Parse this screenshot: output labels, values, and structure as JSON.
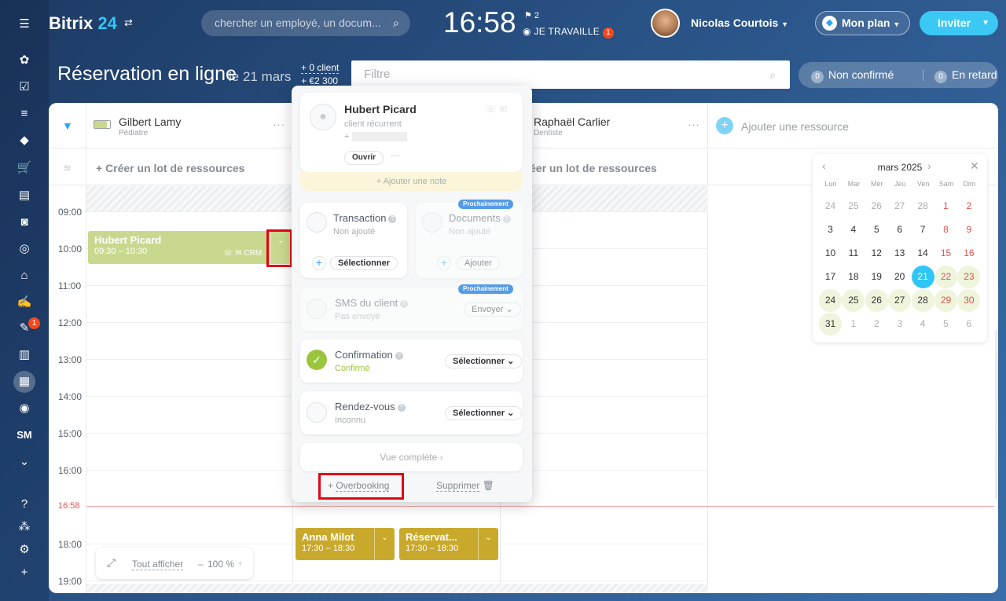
{
  "header": {
    "logo_text": "Bitrix",
    "logo_num": "24",
    "search_placeholder": "chercher un employé, un docum...",
    "clock": "16:58",
    "flag_count": "2",
    "work_status": "JE TRAVAILLE",
    "work_badge": "1",
    "user_name": "Nicolas Courtois",
    "plan_label": "Mon plan",
    "invite_label": "Inviter"
  },
  "sidebar": {
    "badge": "1",
    "sm_label": "SM"
  },
  "page": {
    "title": "Réservation en ligne",
    "date": "le 21 mars",
    "stat_clients": "+ 0 client",
    "stat_money": "+ €2 300",
    "filter_placeholder": "Filtre",
    "unconfirmed_count": "0",
    "unconfirmed_label": "Non confirmé",
    "late_count": "0",
    "late_label": "En retard"
  },
  "resources": [
    {
      "name": "Gilbert Lamy",
      "role": "Pédiatre"
    },
    {
      "name": "Raphaël Carlier",
      "role": "Dentiste"
    }
  ],
  "add_resource": "Ajouter une ressource",
  "create_lot": "+ Créer un lot de ressources",
  "create_lot_partial": "éer un lot de ressources",
  "hours": [
    "09:00",
    "10:00",
    "11:00",
    "12:00",
    "13:00",
    "14:00",
    "15:00",
    "16:00",
    "18:00",
    "19:00"
  ],
  "now_label": "16:58",
  "events": [
    {
      "name": "Hubert Picard",
      "time": "09:30 – 10:30"
    },
    {
      "name": "Anna Milot",
      "time": "17:30 – 18:30"
    },
    {
      "name": "Réservat...",
      "time": "17:30 – 18:30"
    }
  ],
  "event_crm_tag": "CRM",
  "zoom": {
    "show_all": "Tout afficher",
    "level": "100 %",
    "minus": "–",
    "plus": "+"
  },
  "calendar": {
    "month": "mars 2025",
    "weekdays": [
      "Lun",
      "Mar",
      "Mer",
      "Jeu",
      "Ven",
      "Sam",
      "Dim"
    ],
    "weeks": [
      [
        "24",
        "25",
        "26",
        "27",
        "28",
        "1",
        "2"
      ],
      [
        "3",
        "4",
        "5",
        "6",
        "7",
        "8",
        "9"
      ],
      [
        "10",
        "11",
        "12",
        "13",
        "14",
        "15",
        "16"
      ],
      [
        "17",
        "18",
        "19",
        "20",
        "21",
        "22",
        "23"
      ],
      [
        "24",
        "25",
        "26",
        "27",
        "28",
        "29",
        "30"
      ],
      [
        "31",
        "1",
        "2",
        "3",
        "4",
        "5",
        "6"
      ]
    ],
    "selected": "21",
    "colors": {
      "selected": "#2fc6f6",
      "weekend": "#e0534d",
      "highlight": "#eef5dc"
    }
  },
  "popup": {
    "client_name": "Hubert Picard",
    "client_type": "client récurrent",
    "client_phone": "+",
    "open_label": "Ouvrir",
    "add_note": "+ Ajouter une note",
    "soon": "Prochainement",
    "transaction": {
      "label": "Transaction",
      "status": "Non ajouté",
      "button": "Sélectionner"
    },
    "documents": {
      "label": "Documents",
      "status": "Non ajouté",
      "button": "Ajouter"
    },
    "sms": {
      "label": "SMS du client",
      "status": "Pas envoyé",
      "button": "Envoyer"
    },
    "confirmation": {
      "label": "Confirmation",
      "status": "Confirmé",
      "button": "Sélectionner"
    },
    "rendezvous": {
      "label": "Rendez-vous",
      "status": "Inconnu",
      "button": "Sélectionner"
    },
    "full_view": "Vue complète",
    "overbooking": "Overbooking",
    "delete": "Supprimer"
  },
  "colors": {
    "accent": "#2fc6f6",
    "event_green": "#c8d98f",
    "event_gold": "#c9a92c",
    "confirm": "#9bc53d",
    "highlight_box": "#e30613"
  }
}
